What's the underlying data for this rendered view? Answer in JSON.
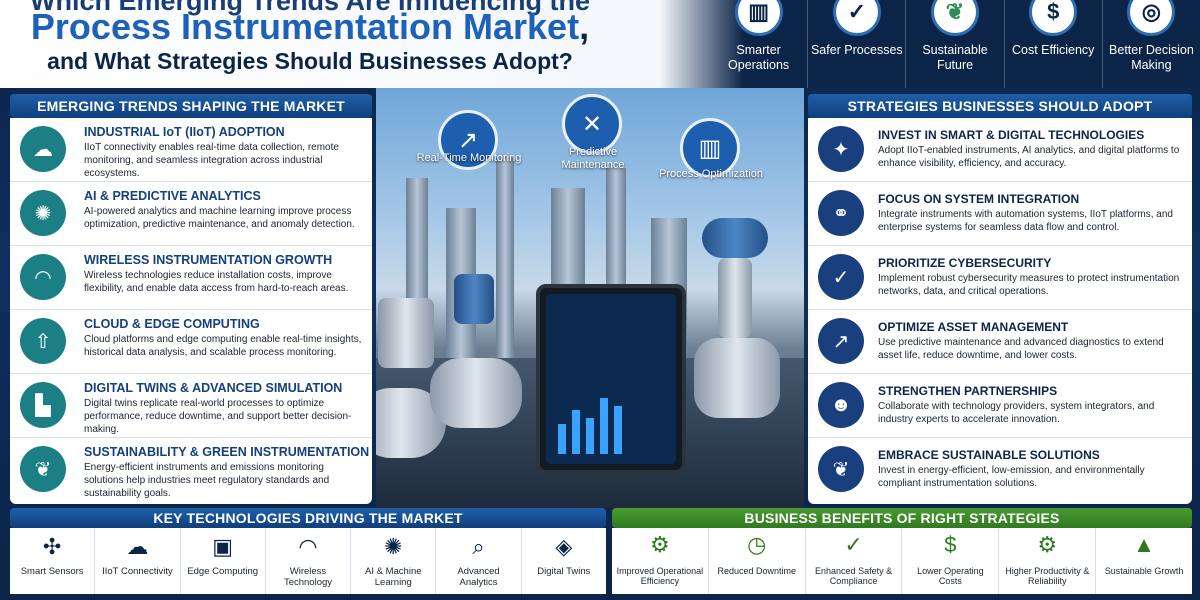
{
  "header": {
    "title_line1": "Which Emerging Trends Are Influencing the",
    "title_line2": "Process Instrumentation Market",
    "title_line2_suffix": ",",
    "title_line3": "and What Strategies Should Businesses Adopt?"
  },
  "top_benefits": [
    {
      "label": "Smarter Operations",
      "icon": "bar-chart-icon"
    },
    {
      "label": "Safer Processes",
      "icon": "shield-check-icon"
    },
    {
      "label": "Sustainable Future",
      "icon": "leaf-icon"
    },
    {
      "label": "Cost Efficiency",
      "icon": "dollar-gear-icon"
    },
    {
      "label": "Better Decision Making",
      "icon": "target-icon"
    }
  ],
  "trends": {
    "heading": "EMERGING TRENDS SHAPING THE MARKET",
    "items": [
      {
        "title": "INDUSTRIAL IoT (IIoT) ADOPTION",
        "desc": "IIoT connectivity enables real-time data collection, remote monitoring, and seamless integration across industrial ecosystems.",
        "icon": "cloud-network-icon"
      },
      {
        "title": "AI & PREDICTIVE ANALYTICS",
        "desc": "AI-powered analytics and machine learning improve process optimization, predictive maintenance, and anomaly detection.",
        "icon": "brain-icon"
      },
      {
        "title": "WIRELESS INSTRUMENTATION GROWTH",
        "desc": "Wireless technologies reduce installation costs, improve flexibility, and enable data access from hard-to-reach areas.",
        "icon": "wifi-icon"
      },
      {
        "title": "CLOUD & EDGE COMPUTING",
        "desc": "Cloud platforms and edge computing enable real-time insights, historical data analysis, and scalable process monitoring.",
        "icon": "cloud-upload-icon"
      },
      {
        "title": "DIGITAL TWINS & ADVANCED SIMULATION",
        "desc": "Digital twins replicate real-world processes to optimize performance, reduce downtime, and support better decision-making.",
        "icon": "factory-icon"
      },
      {
        "title": "SUSTAINABILITY & GREEN INSTRUMENTATION",
        "desc": "Energy-efficient instruments and emissions monitoring solutions help industries meet regulatory standards and sustainability goals.",
        "icon": "leaf-icon"
      }
    ]
  },
  "hero": {
    "badges": [
      {
        "label": "Real-Time Monitoring",
        "icon": "chart-up-icon"
      },
      {
        "label": "Predictive Maintenance",
        "icon": "wrench-icon"
      },
      {
        "label": "Process Optimization",
        "icon": "bar-chart-icon"
      }
    ]
  },
  "strategies": {
    "heading": "STRATEGIES BUSINESSES SHOULD ADOPT",
    "items": [
      {
        "title": "INVEST IN SMART & DIGITAL TECHNOLOGIES",
        "desc": "Adopt IIoT-enabled instruments, AI analytics, and digital platforms to enhance visibility, efficiency, and accuracy.",
        "icon": "lightbulb-icon"
      },
      {
        "title": "FOCUS ON SYSTEM INTEGRATION",
        "desc": "Integrate instruments with automation systems, IIoT platforms, and enterprise systems for seamless data flow and control.",
        "icon": "handshake-icon"
      },
      {
        "title": "PRIORITIZE CYBERSECURITY",
        "desc": "Implement robust cybersecurity measures to protect instrumentation networks, data, and critical operations.",
        "icon": "shield-check-icon"
      },
      {
        "title": "OPTIMIZE ASSET MANAGEMENT",
        "desc": "Use predictive maintenance and advanced diagnostics to extend asset life, reduce downtime, and lower costs.",
        "icon": "chart-up-icon"
      },
      {
        "title": "STRENGTHEN PARTNERSHIPS",
        "desc": "Collaborate with technology providers, system integrators, and industry experts to accelerate innovation.",
        "icon": "people-icon"
      },
      {
        "title": "EMBRACE SUSTAINABLE SOLUTIONS",
        "desc": "Invest in energy-efficient, low-emission, and environmentally compliant instrumentation solutions.",
        "icon": "sprout-icon"
      }
    ]
  },
  "technologies": {
    "heading": "KEY TECHNOLOGIES DRIVING THE MARKET",
    "items": [
      {
        "label": "Smart Sensors",
        "icon": "sensor-icon"
      },
      {
        "label": "IIoT Connectivity",
        "icon": "cloud-network-icon"
      },
      {
        "label": "Edge Computing",
        "icon": "chip-icon"
      },
      {
        "label": "Wireless Technology",
        "icon": "wifi-icon"
      },
      {
        "label": "AI & Machine Learning",
        "icon": "brain-icon"
      },
      {
        "label": "Advanced Analytics",
        "icon": "magnifier-chart-icon"
      },
      {
        "label": "Digital Twins",
        "icon": "cube-icon"
      }
    ]
  },
  "business_benefits": {
    "heading": "BUSINESS BENEFITS OF RIGHT STRATEGIES",
    "items": [
      {
        "label": "Improved Operational Efficiency",
        "icon": "gears-icon"
      },
      {
        "label": "Reduced Downtime",
        "icon": "clock-icon"
      },
      {
        "label": "Enhanced Safety & Compliance",
        "icon": "shield-check-icon"
      },
      {
        "label": "Lower Operating Costs",
        "icon": "dollar-down-icon"
      },
      {
        "label": "Higher Productivity & Reliability",
        "icon": "gear-check-icon"
      },
      {
        "label": "Sustainable Growth",
        "icon": "growth-icon"
      }
    ]
  },
  "colors": {
    "navy": "#0b2447",
    "accent_blue": "#1d62b8",
    "teal": "#1d7f86",
    "green": "#2f7a1f"
  }
}
